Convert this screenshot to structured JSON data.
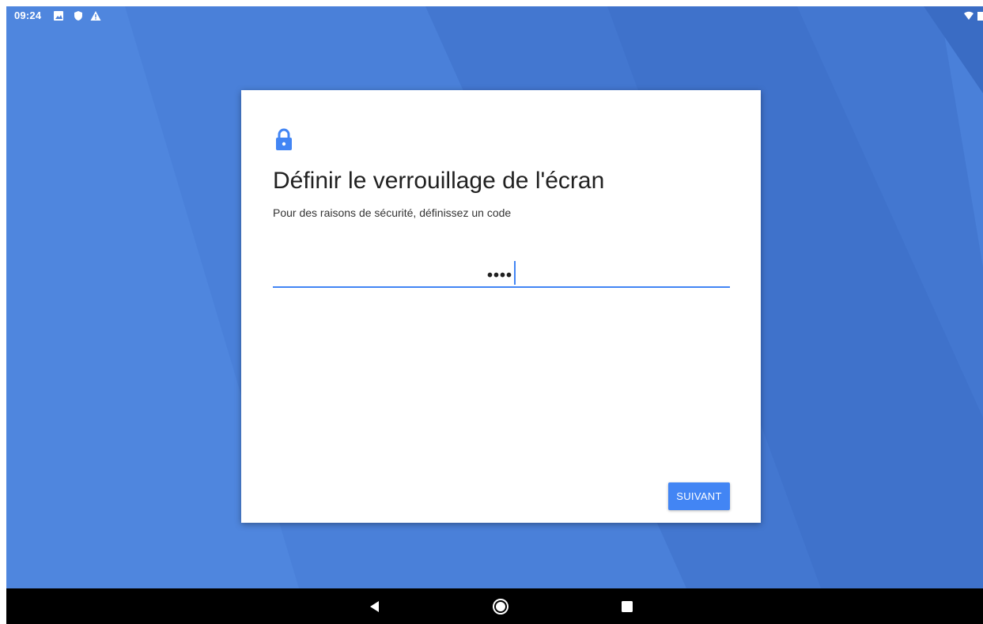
{
  "status_bar": {
    "time": "09:24",
    "icons": [
      "image-icon",
      "shield-icon",
      "warning-icon",
      "wifi-icon",
      "battery-icon"
    ]
  },
  "dialog": {
    "icon": "lock-icon",
    "title": "Définir le verrouillage de l'écran",
    "subtitle": "Pour des raisons de sécurité, définissez un code",
    "pin_input": {
      "value": "••••",
      "placeholder": ""
    },
    "next_label": "SUIVANT"
  },
  "nav_bar": {
    "buttons": [
      "back-icon",
      "home-icon",
      "recents-icon"
    ]
  },
  "colors": {
    "accent": "#4285f4",
    "wallpaper": "#4a80d9",
    "nav_bar": "#000000",
    "card": "#ffffff"
  }
}
